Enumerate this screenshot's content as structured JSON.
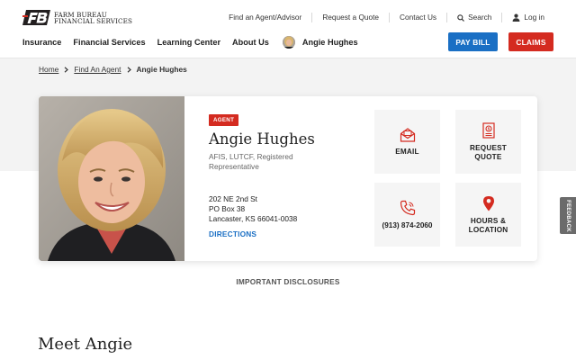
{
  "brand": {
    "line1": "FARM BUREAU",
    "line2": "FINANCIAL SERVICES",
    "mark_color": "#231f20",
    "accent_red": "#d42b20",
    "accent_blue": "#1a6fc4"
  },
  "utility_nav": {
    "find_agent": "Find an Agent/Advisor",
    "request_quote": "Request a Quote",
    "contact_us": "Contact Us",
    "search": "Search",
    "login": "Log in",
    "search_icon": "search-icon",
    "user_icon": "user-icon"
  },
  "main_nav": {
    "items": [
      "Insurance",
      "Financial Services",
      "Learning Center",
      "About Us"
    ],
    "agent_name": "Angie Hughes"
  },
  "buttons": {
    "pay_bill": "PAY BILL",
    "claims": "CLAIMS"
  },
  "breadcrumb": {
    "home": "Home",
    "find_agent": "Find An Agent",
    "current": "Angie Hughes"
  },
  "agent": {
    "badge": "AGENT",
    "name": "Angie Hughes",
    "title": "AFIS, LUTCF, Registered Representative",
    "address_line1": "202 NE 2nd St",
    "address_line2": "PO Box 38",
    "address_line3": "Lancaster, KS 66041-0038",
    "directions": "DIRECTIONS"
  },
  "tiles": {
    "email": "EMAIL",
    "quote_line1": "REQUEST",
    "quote_line2": "QUOTE",
    "phone": "(913) 874-2060",
    "hours_line1": "HOURS &",
    "hours_line2": "LOCATION",
    "icons": [
      "envelope-icon",
      "document-icon",
      "phone-icon",
      "map-pin-icon"
    ]
  },
  "disclosures": "IMPORTANT DISCLOSURES",
  "meet_heading": "Meet Angie",
  "feedback": "FEEDBACK"
}
